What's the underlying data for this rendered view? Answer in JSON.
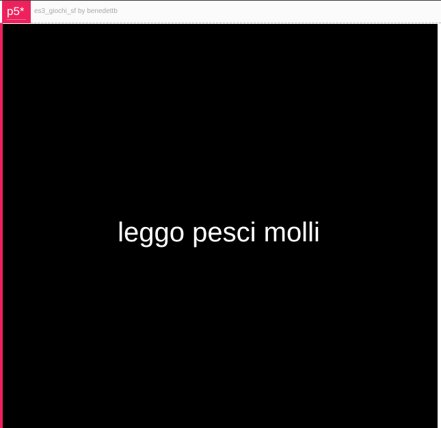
{
  "header": {
    "logo_label": "p5*",
    "sketch_name": "es3_giochi_sf",
    "by_word": "by",
    "author": "benedettb"
  },
  "canvas": {
    "text": "leggo pesci molli",
    "background_color": "#000000",
    "text_color": "#ffffff"
  },
  "colors": {
    "accent": "#ed225d"
  }
}
